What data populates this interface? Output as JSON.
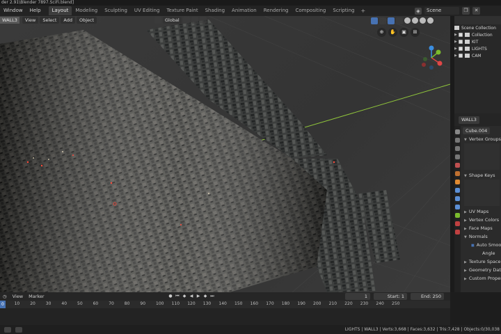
{
  "window": {
    "title": "der 2.91\\Blender 7897.SciFi.blend]"
  },
  "menu": {
    "items": [
      "Window",
      "Help"
    ]
  },
  "workspace_tabs": [
    "Layout",
    "Modeling",
    "Sculpting",
    "UV Editing",
    "Texture Paint",
    "Shading",
    "Animation",
    "Rendering",
    "Compositing",
    "Scripting"
  ],
  "workspace_active": "Layout",
  "add_workspace": "+",
  "scene": {
    "name": "Scene"
  },
  "viewport": {
    "object_label": "WALL3",
    "menus": [
      "View",
      "Select",
      "Add",
      "Object"
    ],
    "orientation": "Global",
    "accent_color": "#4772b3"
  },
  "outliner": {
    "title": "Scene Collection",
    "rows": [
      {
        "label": "Collection"
      },
      {
        "label": "KIT"
      },
      {
        "label": "LIGHTS"
      },
      {
        "label": "CAM"
      }
    ]
  },
  "properties": {
    "object_name": "WALL3",
    "mesh_name": "Cube.004",
    "panels": [
      "Vertex Groups",
      "Shape Keys",
      "UV Maps",
      "Vertex Colors",
      "Face Maps",
      "Normals",
      "Texture Space",
      "Geometry Data",
      "Custom Properties"
    ],
    "normals_option": "Auto Smooth",
    "angle_label": "Angle"
  },
  "timeline": {
    "menus": [
      "View",
      "Marker"
    ],
    "current_frame": "1",
    "start_label": "Start:",
    "start": "1",
    "end_label": "End:",
    "end": "250",
    "ruler": [
      "0",
      "10",
      "20",
      "30",
      "40",
      "50",
      "60",
      "70",
      "80",
      "90",
      "100",
      "110",
      "120",
      "130",
      "140",
      "150",
      "160",
      "170",
      "180",
      "190",
      "200",
      "210",
      "220",
      "230",
      "240",
      "250"
    ]
  },
  "status_bar": {
    "text": "LIGHTS | WALL3 | Verts:3,668 | Faces:3,632 | Tris:7,428 | Objects:0/30,038"
  }
}
